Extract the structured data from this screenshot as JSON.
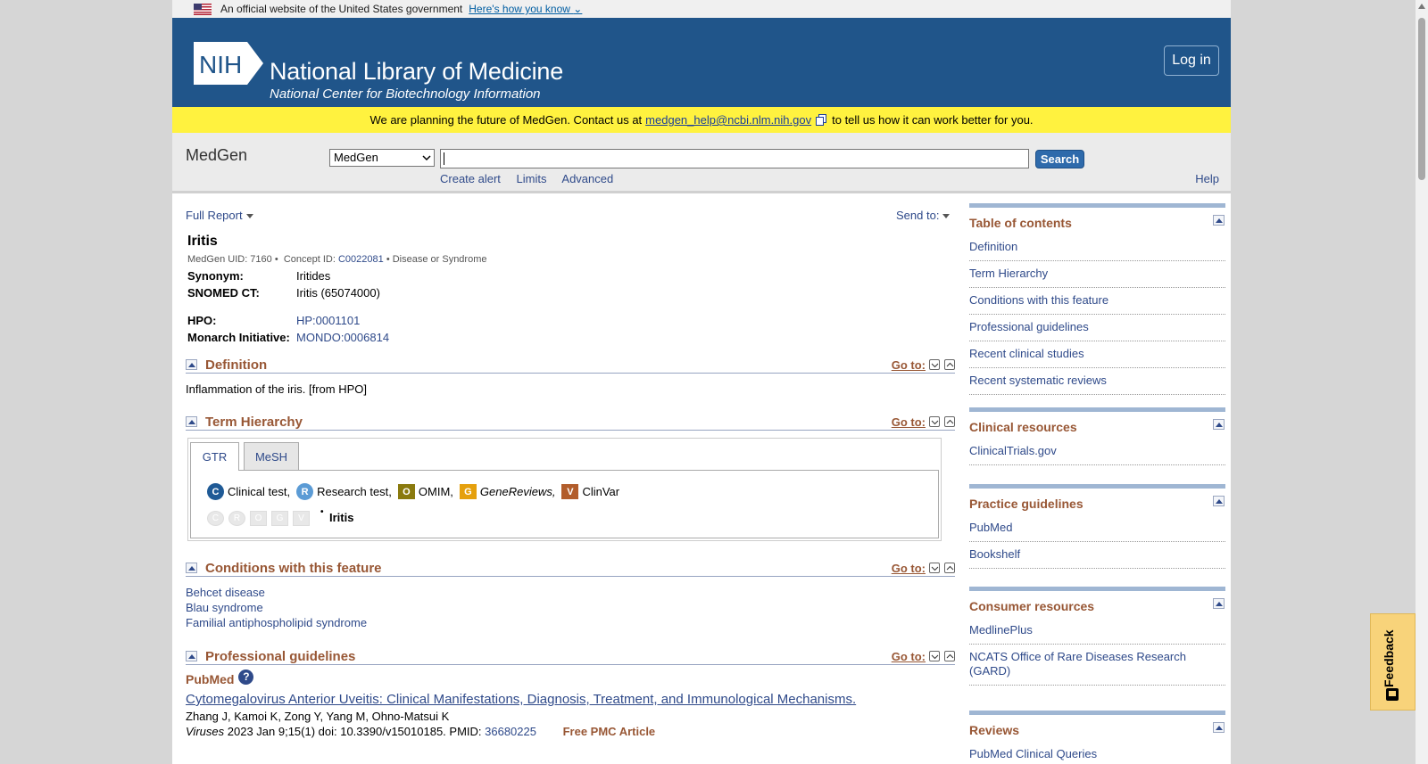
{
  "gov_banner": {
    "text": "An official website of the United States government",
    "link": "Here's how you know"
  },
  "header": {
    "title": "National Library of Medicine",
    "subtitle": "National Center for Biotechnology Information",
    "logo_text": "NIH",
    "login": "Log in"
  },
  "announcement": {
    "before": "We are planning the future of MedGen. Contact us at",
    "email": "medgen_help@ncbi.nlm.nih.gov",
    "after": "to tell us how it can work better for you."
  },
  "search": {
    "db_name": "MedGen",
    "db_selected": "MedGen",
    "value": "",
    "button": "Search",
    "links": [
      "Create alert",
      "Limits",
      "Advanced"
    ],
    "help": "Help"
  },
  "toolbar": {
    "full_report": "Full Report",
    "send_to": "Send to:"
  },
  "record": {
    "title": "Iritis",
    "uid_label": "MedGen UID: 7160 •",
    "concept_label": "Concept ID:",
    "concept_id": "C0022081",
    "type": "• Disease or Syndrome",
    "synonym_label": "Synonym:",
    "synonym": "Iritides",
    "snomed_label": "SNOMED CT:",
    "snomed": "Iritis (65074000)",
    "hpo_label": "HPO:",
    "hpo": "HP:0001101",
    "monarch_label": "Monarch Initiative:",
    "monarch": "MONDO:0006814"
  },
  "goto_label": "Go to:",
  "sections": {
    "definition": {
      "title": "Definition",
      "text": "Inflammation of the iris. [from HPO]"
    },
    "hierarchy": {
      "title": "Term Hierarchy",
      "tabs": [
        "GTR",
        "MeSH"
      ],
      "legend": [
        {
          "letter": "C",
          "label": "Clinical test,",
          "color": "#1f5a96",
          "shape": "circle"
        },
        {
          "letter": "R",
          "label": "Research test,",
          "color": "#5b9bd5",
          "shape": "circle"
        },
        {
          "letter": "O",
          "label": "OMIM,",
          "color": "#8a7a0e",
          "shape": "square"
        },
        {
          "letter": "G",
          "label": "GeneReviews,",
          "color": "#e5a00d",
          "shape": "square"
        },
        {
          "letter": "V",
          "label": "ClinVar",
          "color": "#b25d2b",
          "shape": "square"
        }
      ],
      "ghost_letters": [
        "C",
        "R",
        "O",
        "G",
        "V"
      ],
      "term": "Iritis"
    },
    "conditions": {
      "title": "Conditions with this feature",
      "items": [
        "Behcet disease",
        "Blau syndrome",
        "Familial antiphospholipid syndrome"
      ]
    },
    "guidelines": {
      "title": "Professional guidelines",
      "source": "PubMed",
      "article_title": "Cytomegalovirus Anterior Uveitis: Clinical Manifestations, Diagnosis, Treatment, and Immunological Mechanisms.",
      "authors": "Zhang J, Kamoi K, Zong Y, Yang M, Ohno-Matsui K",
      "journal": "Viruses",
      "citation": "2023 Jan 9;15(1) doi: 10.3390/v15010185. PMID:",
      "pmid": "36680225",
      "free": "Free PMC Article"
    }
  },
  "sidebar": {
    "toc": {
      "title": "Table of contents",
      "items": [
        "Definition",
        "Term Hierarchy",
        "Conditions with this feature",
        "Professional guidelines",
        "Recent clinical studies",
        "Recent systematic reviews"
      ]
    },
    "clinical": {
      "title": "Clinical resources",
      "items": [
        "ClinicalTrials.gov"
      ]
    },
    "practice": {
      "title": "Practice guidelines",
      "items": [
        "PubMed",
        "Bookshelf"
      ]
    },
    "consumer": {
      "title": "Consumer resources",
      "items": [
        "MedlinePlus",
        "NCATS Office of Rare Diseases Research (GARD)"
      ]
    },
    "reviews": {
      "title": "Reviews",
      "items": [
        "PubMed Clinical Queries"
      ]
    }
  },
  "feedback": "Feedback"
}
